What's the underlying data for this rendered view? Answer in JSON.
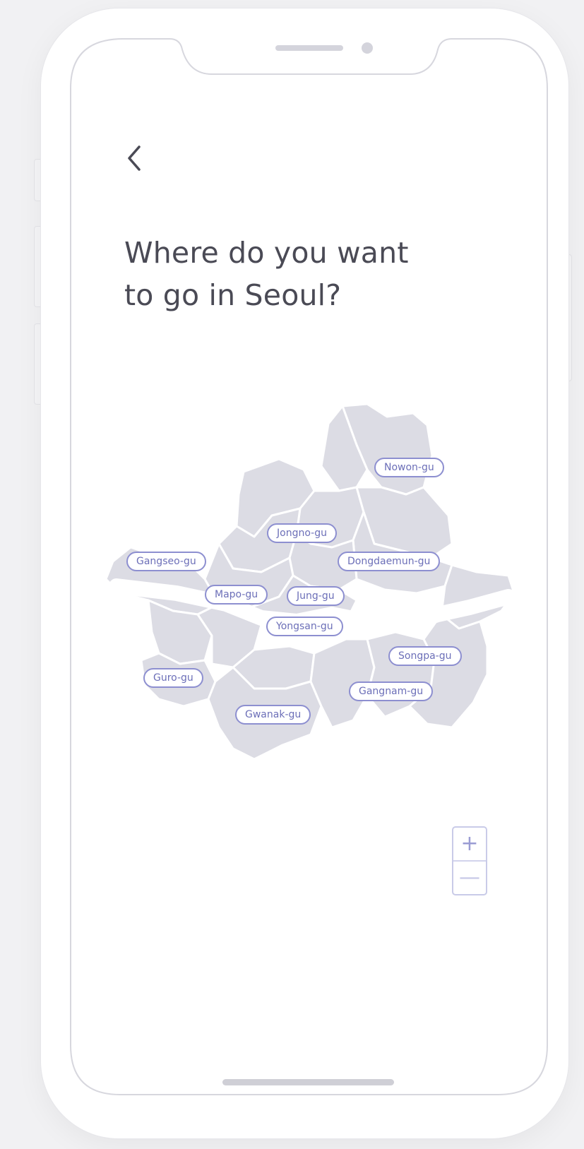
{
  "screen": {
    "title_line1": "Where do you want",
    "title_line2": "to go in Seoul?"
  },
  "icons": {
    "back": "chevron-left-icon",
    "zoom_in": "plus-icon",
    "zoom_out": "minus-icon"
  },
  "map": {
    "region": "Seoul",
    "districts": [
      "Nowon-gu",
      "Jongno-gu",
      "Gangseo-gu",
      "Dongdaemun-gu",
      "Mapo-gu",
      "Jung-gu",
      "Yongsan-gu",
      "Songpa-gu",
      "Guro-gu",
      "Gangnam-gu",
      "Gwanak-gu"
    ]
  },
  "zoom": {
    "plus": "+",
    "minus": "—"
  },
  "colors": {
    "accent": "#8d8fd0",
    "label_text": "#6c6fb8",
    "map_fill": "#dcdce4",
    "title_text": "#4a4a55"
  }
}
